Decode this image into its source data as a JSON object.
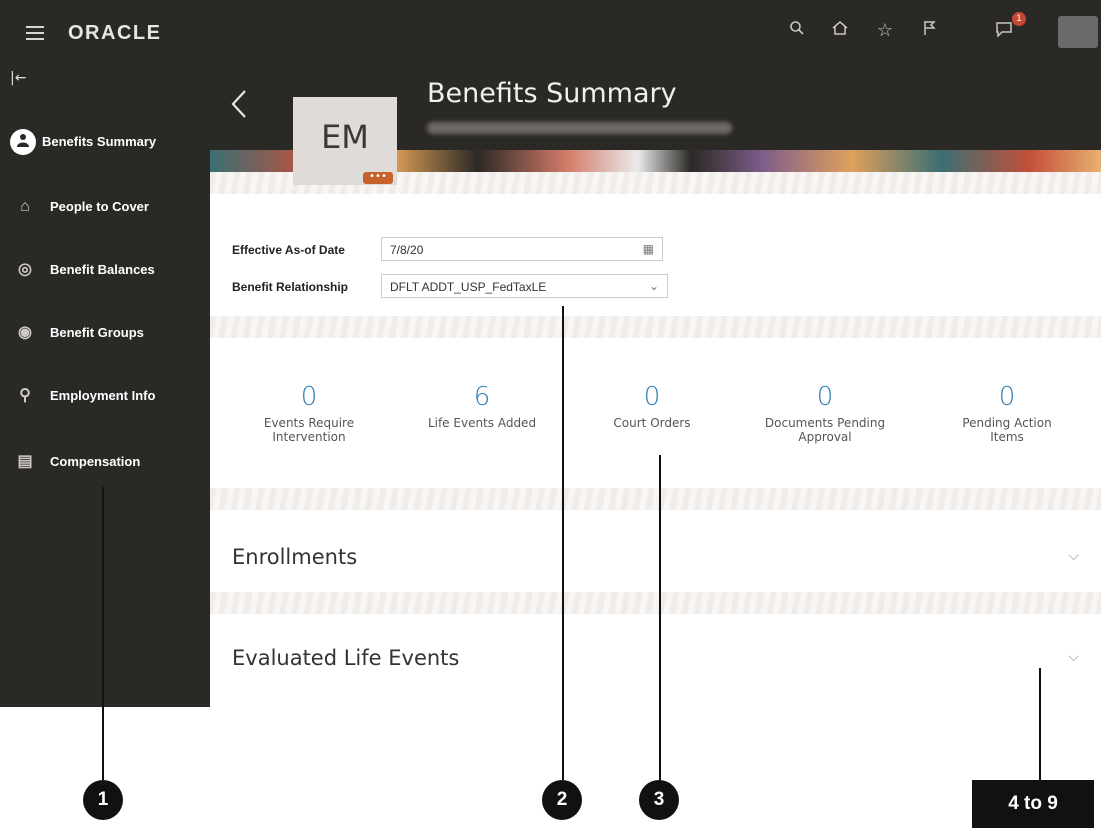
{
  "header": {
    "logo": "ORACLE",
    "title": "Benefits Summary",
    "avatar_initials": "EM",
    "avatar_menu": "•••",
    "notification_count": "1"
  },
  "icons": {
    "hamburger": "menu-icon",
    "search": "search-icon",
    "home": "home-icon",
    "favorites": "star-icon",
    "flag": "flag-icon",
    "notifications": "notification-icon",
    "collapse": "collapse-icon",
    "back": "chevron-left-icon",
    "calendar": "calendar-icon",
    "dropdown": "chevron-down-icon"
  },
  "sidebar": {
    "items": [
      {
        "label": "Benefits Summary",
        "icon": "person-icon"
      },
      {
        "label": "People to Cover",
        "icon": "house-people-icon"
      },
      {
        "label": "Benefit Balances",
        "icon": "coins-icon"
      },
      {
        "label": "Benefit Groups",
        "icon": "group-icon"
      },
      {
        "label": "Employment Info",
        "icon": "briefcase-person-icon"
      },
      {
        "label": "Compensation",
        "icon": "money-icon"
      }
    ]
  },
  "form": {
    "effective_date_label": "Effective As-of Date",
    "effective_date_value": "7/8/20",
    "relationship_label": "Benefit Relationship",
    "relationship_value": "DFLT ADDT_USP_FedTaxLE"
  },
  "metrics": [
    {
      "value": "0",
      "caption": "Events Require Intervention"
    },
    {
      "value": "6",
      "caption": "Life Events Added"
    },
    {
      "value": "0",
      "caption": "Court Orders"
    },
    {
      "value": "0",
      "caption": "Documents Pending Approval"
    },
    {
      "value": "0",
      "caption": "Pending Action Items"
    }
  ],
  "sections": [
    {
      "title": "Enrollments"
    },
    {
      "title": "Evaluated Life Events"
    }
  ],
  "callouts": {
    "one": "1",
    "two": "2",
    "three": "3",
    "range": "4 to 9"
  },
  "colors": {
    "sidebar_bg": "#2b2926",
    "metric_blue": "#2f7fb3",
    "badge_red": "#c74634",
    "avatar_menu_orange": "#c8622d"
  }
}
